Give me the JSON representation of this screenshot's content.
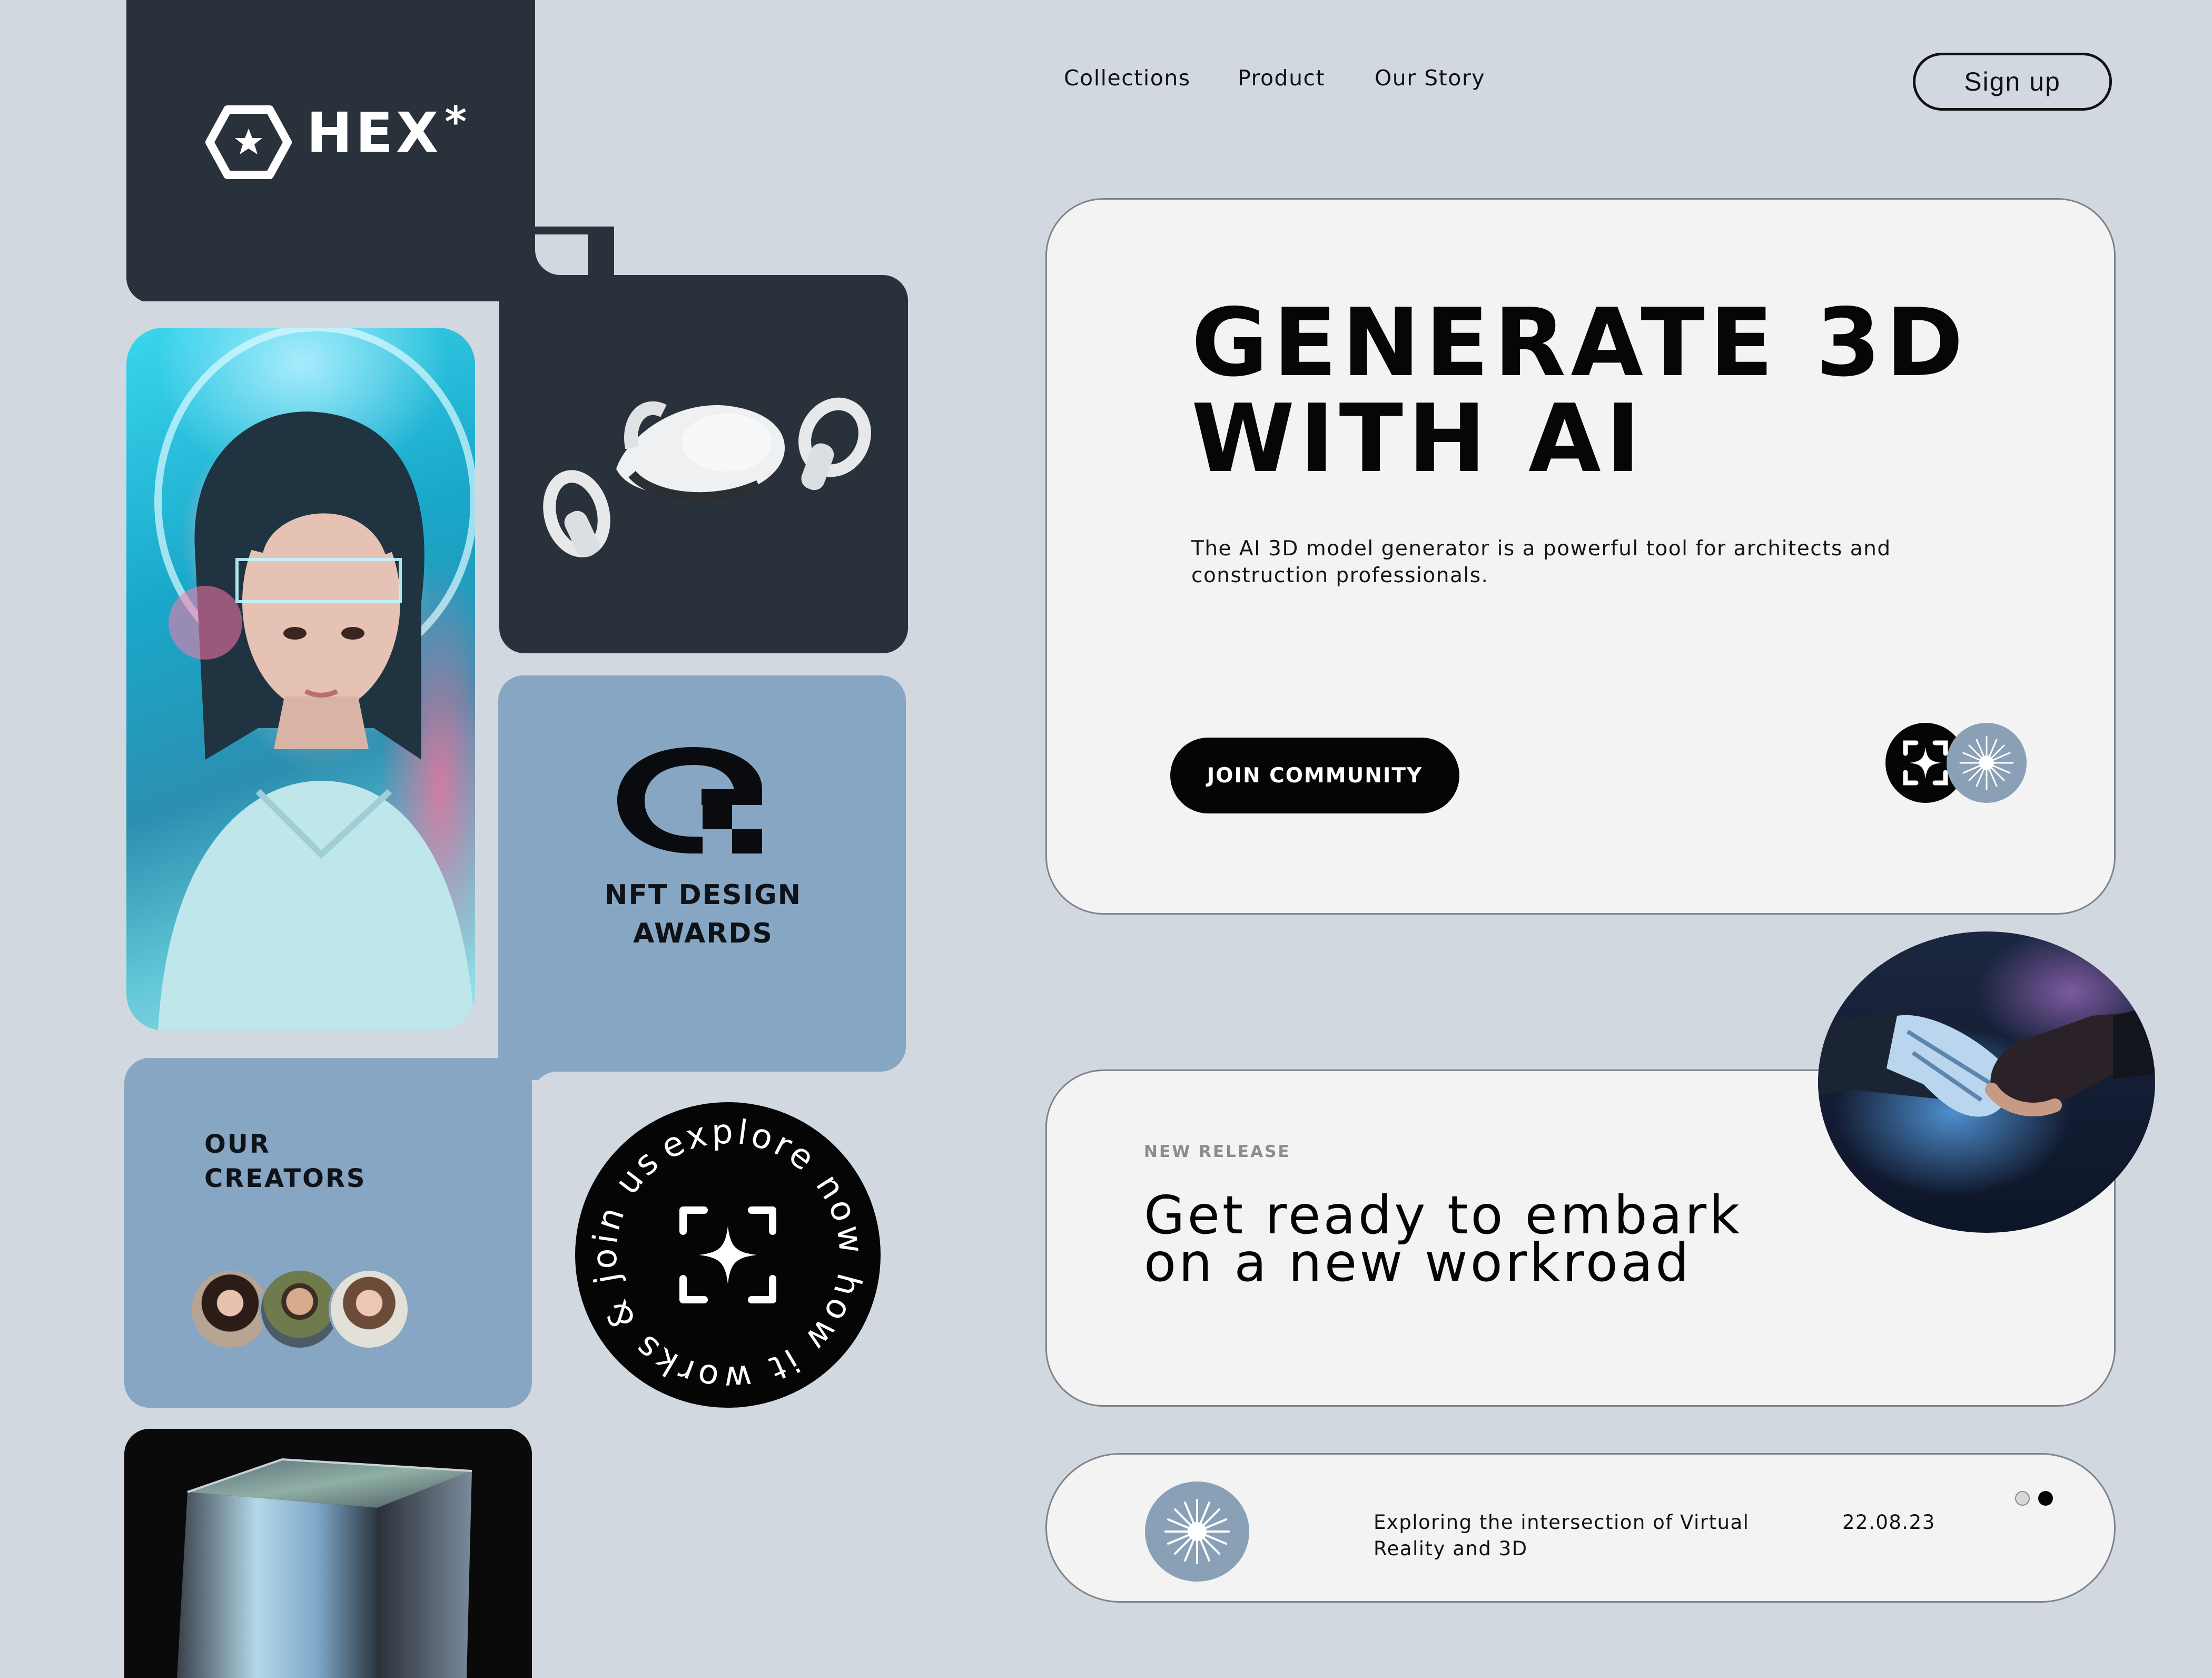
{
  "brand": {
    "name": "HEX",
    "asterisk": "*",
    "icon": "hexagon-star-logo-icon"
  },
  "nav": {
    "links": [
      {
        "label": "Collections"
      },
      {
        "label": "Product"
      },
      {
        "label": "Our Story"
      }
    ],
    "signup_label": "Sign up"
  },
  "awards": {
    "label": "NFT DESIGN\nAWARDS",
    "icon": "nft-award-logo-icon"
  },
  "creators": {
    "label": "OUR\nCREATORS",
    "avatars": [
      "creator-avatar-1",
      "creator-avatar-2",
      "creator-avatar-3"
    ]
  },
  "badge": {
    "ring_text": "explore now how it works & join us",
    "icon": "focus-sparkle-icon"
  },
  "hero": {
    "title": "GENERATE 3D\nWITH AI",
    "description": "The AI 3D model generator is a powerful tool for architects and construction professionals.",
    "cta_label": "JOIN COMMUNITY"
  },
  "release": {
    "eyebrow": "NEW RELEASE",
    "title": "Get ready to embark\non a new workroad"
  },
  "news": {
    "text": "Exploring the intersection of Virtual Reality and 3D",
    "date": "22.08.23",
    "active_dot": 2
  },
  "colors": {
    "background": "#d2d8df",
    "dark_panel": "#29313b",
    "blue_panel": "#86a6c4",
    "card": "#f3f3f3",
    "accent_blue": "#8aa0b6"
  }
}
